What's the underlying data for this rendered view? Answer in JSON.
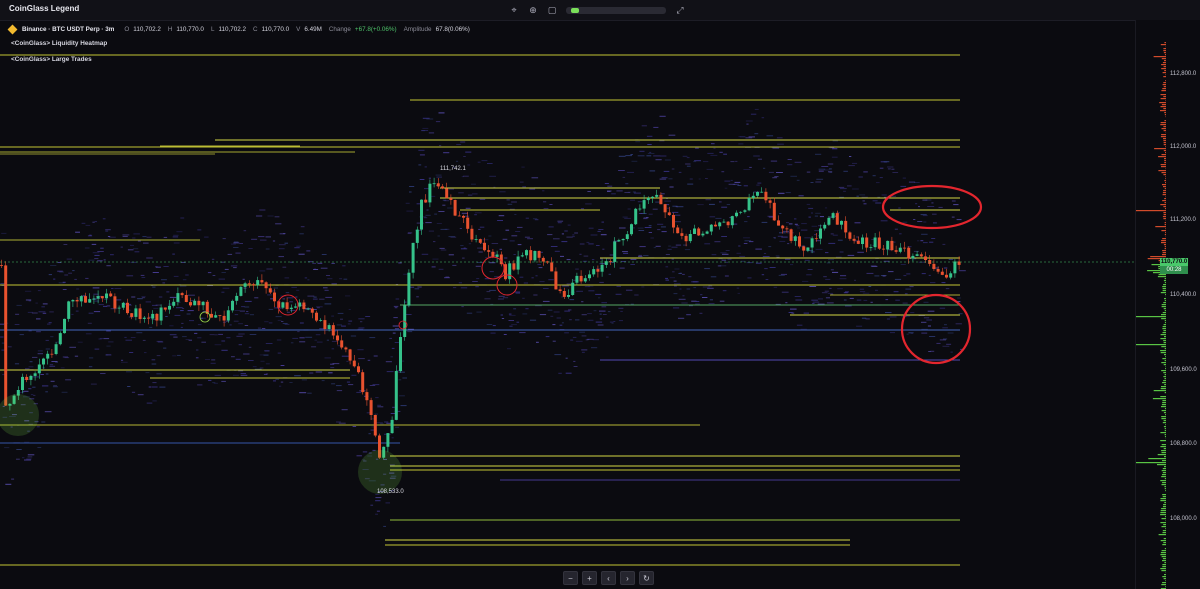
{
  "app": {
    "title": "CoinGlass Legend"
  },
  "toolbar": {
    "tools": [
      {
        "name": "crosshair-icon",
        "glyph": "⌖"
      },
      {
        "name": "zoom-icon",
        "glyph": "⊕"
      },
      {
        "name": "square-icon",
        "glyph": "▢"
      },
      {
        "name": "fullscreen-icon",
        "glyph": "⤢"
      }
    ],
    "range_fraction": 0.05
  },
  "symbol_info": {
    "symbol": "Binance · BTC USDT Perp · 3m",
    "open_label": "O",
    "open": "110,702.2",
    "high_label": "H",
    "high": "110,770.0",
    "low_label": "L",
    "low": "110,702.2",
    "close_label": "C",
    "close": "110,770.0",
    "volume_label": "V",
    "volume": "6.49M",
    "change_label": "Change",
    "change": "+67.8(+0.06%)",
    "amplitude_label": "Amplitude",
    "amplitude": "67.8(0.06%)"
  },
  "indicators": [
    "<CoinGlass> Liquidity Heatmap",
    "<CoinGlass> Large Trades"
  ],
  "price_axis": {
    "ticks": [
      "112,800.0",
      "112,000.0",
      "111,200.0",
      "110,400.0",
      "109,600.0",
      "108,800.0",
      "108,000.0"
    ],
    "last_price": "110,770.0",
    "countdown": "00:28"
  },
  "annotations": {
    "high_label": "111,742.1",
    "low_label": "108,533.0"
  },
  "nav": {
    "buttons": [
      {
        "name": "zoom-out-button",
        "glyph": "−"
      },
      {
        "name": "zoom-in-button",
        "glyph": "+"
      },
      {
        "name": "scroll-left-button",
        "glyph": "‹"
      },
      {
        "name": "scroll-right-button",
        "glyph": "›"
      },
      {
        "name": "reset-button",
        "glyph": "↻"
      }
    ]
  },
  "colors": {
    "background": "#0b0b10",
    "up": "#35c28a",
    "down": "#e8522f",
    "liquidity_line": "#e9ee4a",
    "heatmap_dot": "#4b3f9e",
    "circle_red": "#e3262e",
    "circle_green": "#7ad84a",
    "last_price": "#49c96a"
  }
}
